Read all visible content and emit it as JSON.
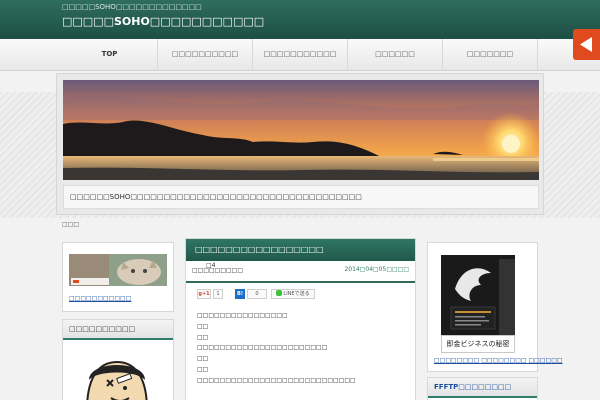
{
  "header": {
    "tagline": "□□□□□SOHO□□□□□□□□□□□□□",
    "title": "□□□□□SOHO□□□□□□□□□□□"
  },
  "nav": {
    "items": [
      "TOP",
      "□□□□□□□□□□",
      "□□□□□□□□□□□",
      "□□□□□□",
      "□□□□□□□"
    ]
  },
  "hero": {
    "caption": "□□□□□□SOHO□□□□□□□□□□□□□□□□□□□□□□□□□□□□□□□□□□□"
  },
  "breadcrumb": "□□□",
  "sidebar_left": {
    "ad_link": "□□□□□□□□□□□",
    "widget_title": "□□□□□□□□□□"
  },
  "post": {
    "title": "□□□□□□□□□□□□□□□□□",
    "number": "□4",
    "tag": "□□□□□□□□□",
    "date": "2014□04□05□□□□",
    "share_gplus": "g+1",
    "share_gcount": "1",
    "share_hatena": "B!",
    "share_hcount": "0",
    "share_line": "LINEで送る",
    "lines": [
      "□□□□□□□□□□□□□□□□",
      "□□",
      "□□",
      "□□□□□□□□□□□□□□□□□□□□□□□",
      "□□",
      "□□",
      "□□□□□□□□□□□□□□□□□□□□□□□□□□□□"
    ]
  },
  "sidebar_right": {
    "book_label": "即金ビジネスの秘密",
    "book_links": "□□□□□□□□ □□□□□□□□ □□□□□□",
    "widget_title": "FFFTP□□□□□□□□"
  },
  "colors": {
    "header_green": "#2f6d5f",
    "accent_orange": "#e04a1f",
    "link_blue": "#1a4fa0"
  }
}
